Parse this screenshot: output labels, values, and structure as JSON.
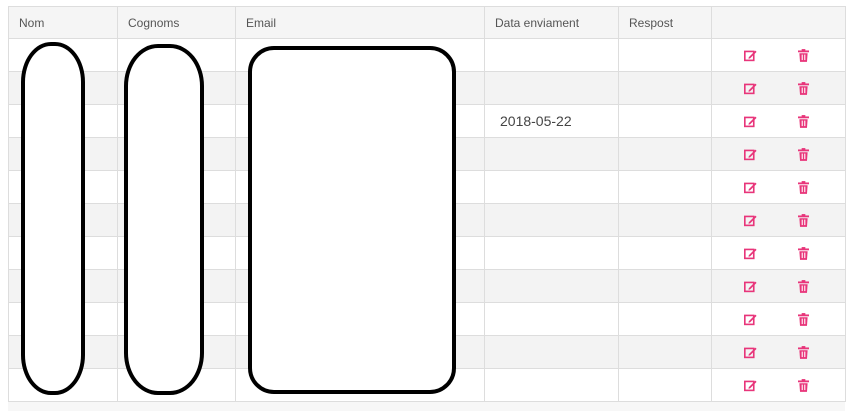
{
  "table": {
    "columns": [
      "Nom",
      "Cognoms",
      "Email",
      "Data enviament",
      "Respost",
      ""
    ],
    "rows": [
      {
        "nom": "",
        "cognoms": "",
        "email": "",
        "data_enviament": "",
        "respost": ""
      },
      {
        "nom": "",
        "cognoms": "",
        "email": "",
        "data_enviament": "",
        "respost": ""
      },
      {
        "nom": "",
        "cognoms": "",
        "email": "",
        "data_enviament": "2018-05-22",
        "respost": ""
      },
      {
        "nom": "",
        "cognoms": "",
        "email": "",
        "data_enviament": "",
        "respost": ""
      },
      {
        "nom": "",
        "cognoms": "",
        "email": "",
        "data_enviament": "",
        "respost": ""
      },
      {
        "nom": "",
        "cognoms": "",
        "email": "",
        "data_enviament": "",
        "respost": ""
      },
      {
        "nom": "",
        "cognoms": "",
        "email": "",
        "data_enviament": "",
        "respost": ""
      },
      {
        "nom": "",
        "cognoms": "",
        "email": "",
        "data_enviament": "",
        "respost": ""
      },
      {
        "nom": "",
        "cognoms": "",
        "email": "",
        "data_enviament": "",
        "respost": ""
      },
      {
        "nom": "",
        "cognoms": "",
        "email": "",
        "data_enviament": "",
        "respost": ""
      },
      {
        "nom": "",
        "cognoms": "",
        "email": "",
        "data_enviament": "",
        "respost": ""
      }
    ],
    "row_actions": [
      {
        "icon": "edit-icon",
        "color": "#e8357a"
      },
      {
        "icon": "trash-icon",
        "color": "#e8357a"
      }
    ]
  },
  "colors": {
    "accent": "#e8357a",
    "border": "#dddddd",
    "stripe": "#f3f3f3"
  }
}
